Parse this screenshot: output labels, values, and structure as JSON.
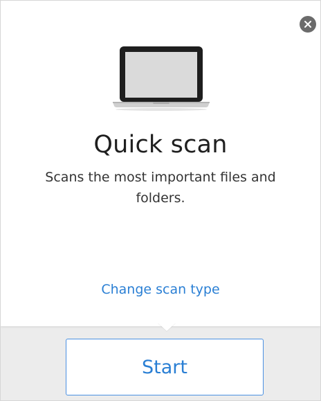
{
  "icons": {
    "close": "close-icon",
    "device": "laptop-icon"
  },
  "panel": {
    "title": "Quick scan",
    "description": "Scans the most important files and folders.",
    "change_link": "Change scan type"
  },
  "footer": {
    "start_label": "Start"
  },
  "colors": {
    "accent": "#2a7fd4",
    "button_border": "#4a90e2",
    "close_bg": "#6b6b6b",
    "footer_bg": "#ececec"
  }
}
